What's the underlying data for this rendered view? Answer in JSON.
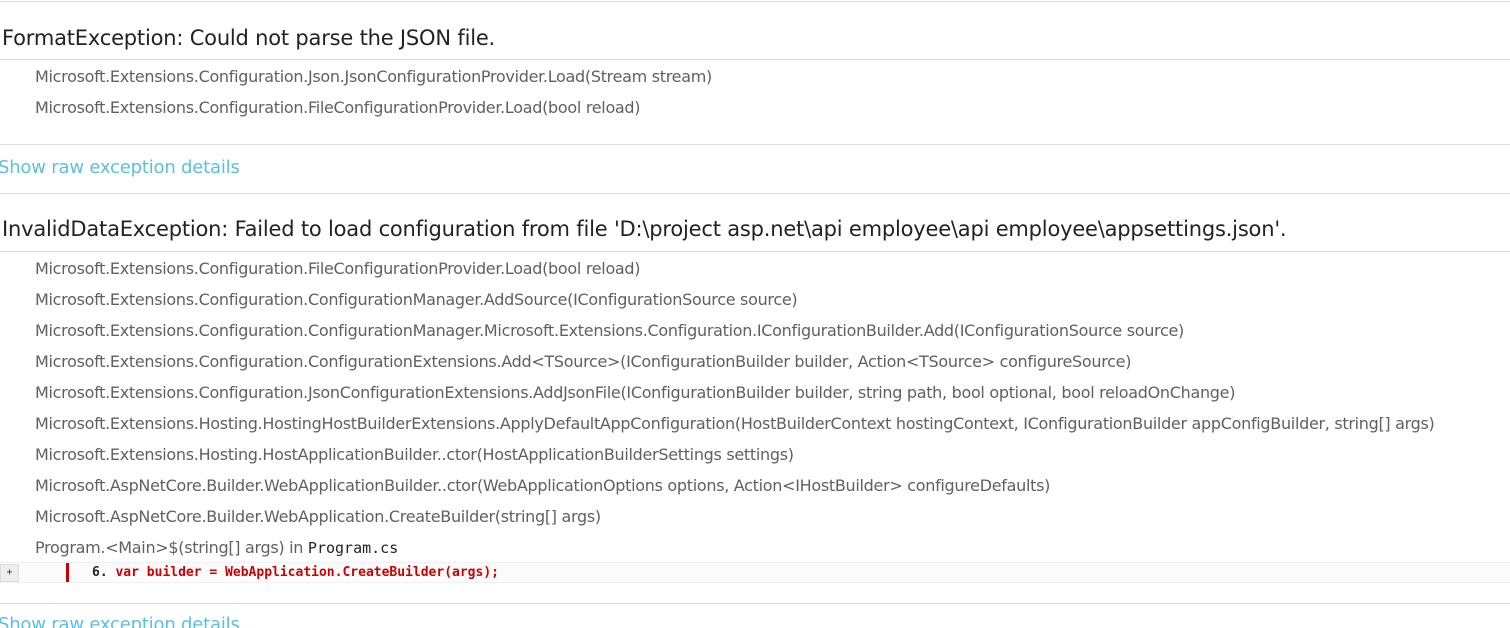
{
  "exceptions": [
    {
      "title": "FormatException: Could not parse the JSON file.",
      "frames": [
        "Microsoft.Extensions.Configuration.Json.JsonConfigurationProvider.Load(Stream stream)",
        "Microsoft.Extensions.Configuration.FileConfigurationProvider.Load(bool reload)"
      ],
      "show_raw_label": "Show raw exception details"
    },
    {
      "title": "InvalidDataException: Failed to load configuration from file 'D:\\project asp.net\\api employee\\api employee\\appsettings.json'.",
      "frames": [
        "Microsoft.Extensions.Configuration.FileConfigurationProvider.Load(bool reload)",
        "Microsoft.Extensions.Configuration.ConfigurationManager.AddSource(IConfigurationSource source)",
        "Microsoft.Extensions.Configuration.ConfigurationManager.Microsoft.Extensions.Configuration.IConfigurationBuilder.Add(IConfigurationSource source)",
        "Microsoft.Extensions.Configuration.ConfigurationExtensions.Add<TSource>(IConfigurationBuilder builder, Action<TSource> configureSource)",
        "Microsoft.Extensions.Configuration.JsonConfigurationExtensions.AddJsonFile(IConfigurationBuilder builder, string path, bool optional, bool reloadOnChange)",
        "Microsoft.Extensions.Hosting.HostingHostBuilderExtensions.ApplyDefaultAppConfiguration(HostBuilderContext hostingContext, IConfigurationBuilder appConfigBuilder, string[] args)",
        "Microsoft.Extensions.Hosting.HostApplicationBuilder..ctor(HostApplicationBuilderSettings settings)",
        "Microsoft.AspNetCore.Builder.WebApplicationBuilder..ctor(WebApplicationOptions options, Action<IHostBuilder> configureDefaults)",
        "Microsoft.AspNetCore.Builder.WebApplication.CreateBuilder(string[] args)"
      ],
      "source_frame": {
        "method": "Program.<Main>$(string[] args) in ",
        "file": "Program.cs",
        "expand_label": "+",
        "line_number": "6.",
        "line_text": "var builder = WebApplication.CreateBuilder(args);"
      },
      "show_raw_label": "Show raw exception details"
    }
  ],
  "colors": {
    "link": "#5bc0de",
    "error_line": "#cc0000",
    "frame_text": "#606060"
  }
}
